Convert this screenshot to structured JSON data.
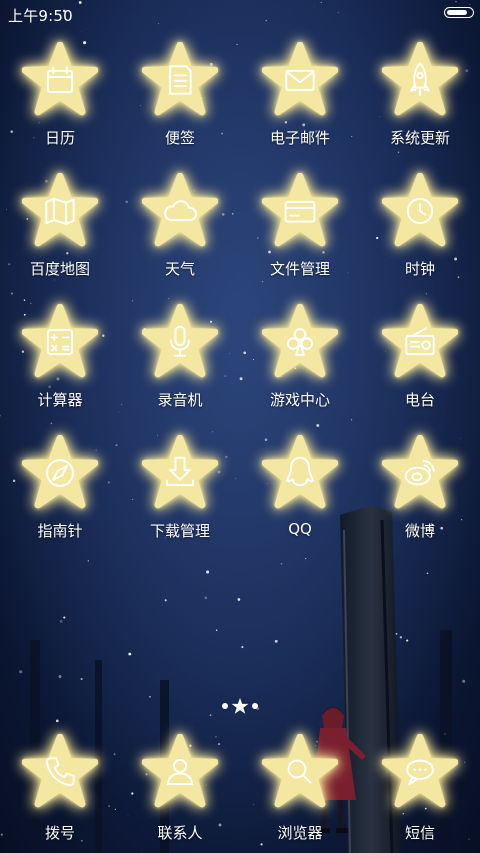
{
  "status_bar": {
    "time": "上午9:50",
    "battery_level": 0.85
  },
  "apps": [
    {
      "label": "日历",
      "icon": "calendar-icon"
    },
    {
      "label": "便签",
      "icon": "notes-icon"
    },
    {
      "label": "电子邮件",
      "icon": "mail-icon"
    },
    {
      "label": "系统更新",
      "icon": "rocket-icon"
    },
    {
      "label": "百度地图",
      "icon": "map-icon"
    },
    {
      "label": "天气",
      "icon": "cloud-icon"
    },
    {
      "label": "文件管理",
      "icon": "folder-card-icon"
    },
    {
      "label": "时钟",
      "icon": "clock-icon"
    },
    {
      "label": "计算器",
      "icon": "calculator-icon"
    },
    {
      "label": "录音机",
      "icon": "microphone-icon"
    },
    {
      "label": "游戏中心",
      "icon": "club-icon"
    },
    {
      "label": "电台",
      "icon": "radio-icon"
    },
    {
      "label": "指南针",
      "icon": "compass-icon"
    },
    {
      "label": "下载管理",
      "icon": "download-icon"
    },
    {
      "label": "QQ",
      "icon": "qq-penguin-icon"
    },
    {
      "label": "微博",
      "icon": "weibo-icon"
    }
  ],
  "page_indicator": {
    "pages": 3,
    "current": 2
  },
  "dock": [
    {
      "label": "拨号",
      "icon": "phone-icon"
    },
    {
      "label": "联系人",
      "icon": "contact-icon"
    },
    {
      "label": "浏览器",
      "icon": "search-icon"
    },
    {
      "label": "短信",
      "icon": "message-icon"
    }
  ],
  "colors": {
    "star_fill": "#f3e7a2",
    "star_glow": "#ffec8c",
    "glyph": "#ffffff",
    "background": "#152650"
  }
}
